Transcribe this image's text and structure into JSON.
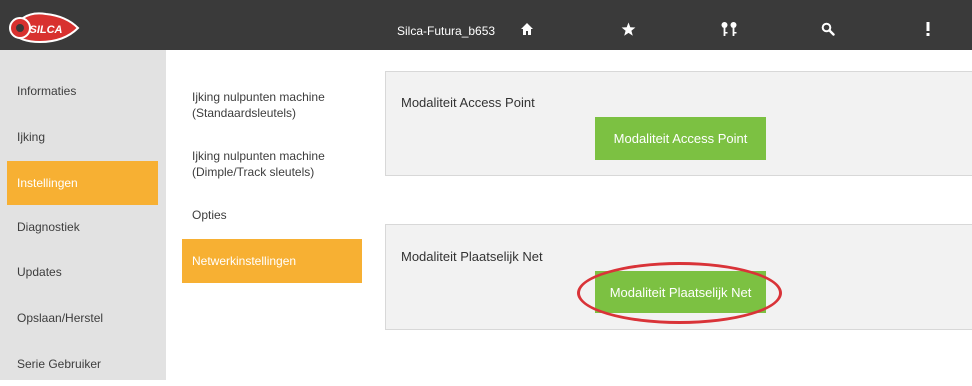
{
  "header": {
    "device_name": "Silca-Futura_b653",
    "logo_text": "SILCA",
    "icons": [
      "home-icon",
      "star-icon",
      "keys-icon",
      "search-icon",
      "more-vertical-icon"
    ]
  },
  "sidebar": {
    "items": [
      {
        "label": "Informaties"
      },
      {
        "label": "Ijking"
      },
      {
        "label": "Instellingen",
        "active": true
      },
      {
        "label": "Diagnostiek"
      },
      {
        "label": "Updates"
      },
      {
        "label": "Opslaan/Herstel"
      },
      {
        "label": "Serie Gebruiker"
      }
    ]
  },
  "submenu": {
    "items": [
      {
        "line1": "Ijking nulpunten machine",
        "line2": "(Standaardsleutels)"
      },
      {
        "line1": "Ijking nulpunten machine",
        "line2": "(Dimple/Track sleutels)"
      },
      {
        "line1": "Opties"
      },
      {
        "line1": "Netwerkinstellingen",
        "active": true
      }
    ]
  },
  "panels": {
    "access_point": {
      "title": "Modaliteit Access Point",
      "button_label": "Modaliteit Access Point"
    },
    "local_network": {
      "title": "Modaliteit Plaatselijk Net",
      "button_label": "Modaliteit Plaatselijk Net"
    }
  },
  "colors": {
    "topbar": "#3a3a3a",
    "accent_orange": "#f7b033",
    "button_green": "#7cc142",
    "highlight_red": "#d93338",
    "sidebar_bg": "#e2e2e2",
    "panel_bg": "#f2f2f2"
  }
}
